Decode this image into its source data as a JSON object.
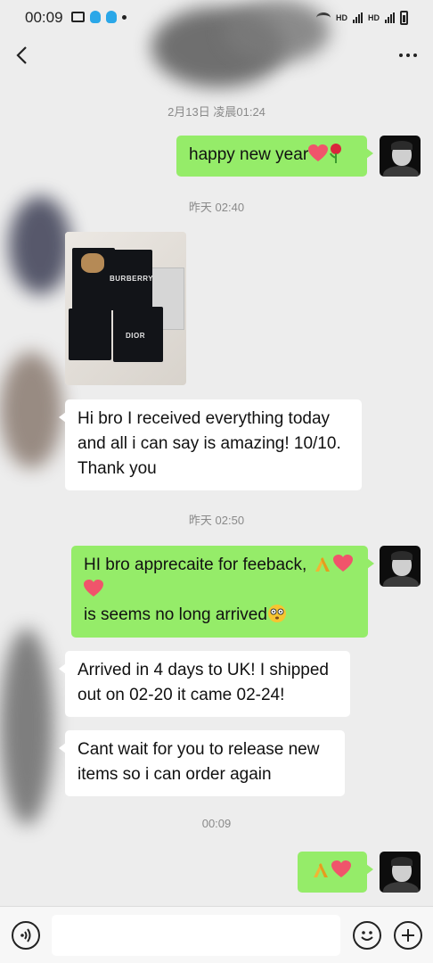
{
  "status_bar": {
    "time": "00:09",
    "hd1": "HD",
    "hd2": "HD"
  },
  "nav": {
    "back_icon": "chevron-left-icon",
    "more_icon": "more-horizontal-icon"
  },
  "messages": [
    {
      "type": "timestamp",
      "text": "2月13日 凌晨01:24"
    },
    {
      "type": "text",
      "side": "right",
      "text": "happy new year",
      "emojis": [
        "red-heart",
        "rose"
      ]
    },
    {
      "type": "timestamp",
      "text": "昨天 02:40"
    },
    {
      "type": "image",
      "side": "left",
      "package_text": "BURBERRY",
      "package_text_2": "DIOR"
    },
    {
      "type": "text",
      "side": "left",
      "text": "Hi bro I received everything today and all i can say is amazing! 10/10. Thank you"
    },
    {
      "type": "timestamp",
      "text": "昨天 02:50"
    },
    {
      "type": "text",
      "side": "right",
      "text": "HI bro apprecaite for feeback,",
      "text2": "is seems no long arrived",
      "emojis": [
        "folded-hands",
        "red-heart",
        "red-heart",
        "flushed-face"
      ]
    },
    {
      "type": "text",
      "side": "left",
      "text": "Arrived in 4 days to UK! I shipped out on 02-20 it came 02-24!"
    },
    {
      "type": "text",
      "side": "left",
      "text": "Cant wait for you to release new items so i can order again"
    },
    {
      "type": "timestamp",
      "text": "00:09"
    },
    {
      "type": "emoji",
      "side": "right",
      "emojis": [
        "folded-hands",
        "red-heart"
      ]
    }
  ],
  "input_bar": {
    "voice_icon": "voice-icon",
    "emoji_icon": "smiley-icon",
    "plus_icon": "plus-circle-icon",
    "placeholder": ""
  },
  "colors": {
    "background": "#ededed",
    "bubble_right": "#95ec69",
    "bubble_left": "#ffffff",
    "timestamp_text": "#8a8a8a"
  }
}
